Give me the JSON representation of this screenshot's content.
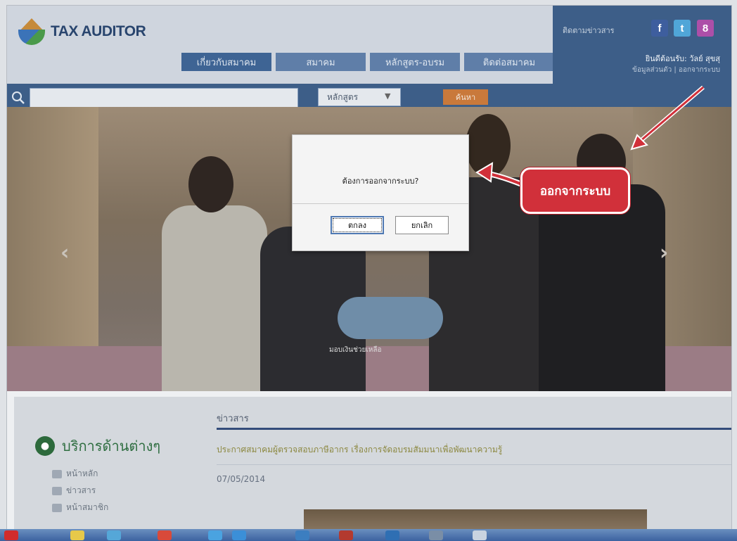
{
  "brand": {
    "logo_text": "TAX AUDITOR",
    "logo_sub": ""
  },
  "nav": {
    "tabs": [
      {
        "label": "เกี่ยวกับสมาคม"
      },
      {
        "label": "สมาคม"
      },
      {
        "label": "หลักสูตร-อบรม"
      },
      {
        "label": "ติดต่อสมาคม"
      }
    ]
  },
  "header_right": {
    "follow_label": "ติดตามข่าวสาร",
    "social": [
      {
        "icon": "facebook-icon",
        "glyph": "f"
      },
      {
        "icon": "twitter-icon",
        "glyph": "t"
      },
      {
        "icon": "googleplus-icon",
        "glyph": "8"
      }
    ],
    "welcome": "ยินดีต้อนรับ: วัลย์ สุขสุ",
    "links": "ข้อมูลส่วนตัว | ออกจากระบบ"
  },
  "search": {
    "placeholder": "",
    "select_value": "หลักสูตร",
    "button_label": "ค้นหา"
  },
  "hero": {
    "caption": "มอบเงินช่วยเหลือ"
  },
  "dialog": {
    "message": "ต้องการออกจากระบบ?",
    "ok_label": "ตกลง",
    "cancel_label": "ยกเลิก"
  },
  "annotation": {
    "text": "ออกจากระบบ"
  },
  "sidebar": {
    "title": "บริการด้านต่างๆ",
    "items": [
      {
        "label": "หน้าหลัก"
      },
      {
        "label": "ข่าวสาร"
      },
      {
        "label": "หน้าสมาชิก"
      }
    ]
  },
  "news": {
    "heading": "ข่าวสาร",
    "title": "ประกาศสมาคมผู้ตรวจสอบภาษีอากร เรื่องการจัดอบรมสัมมนาเพื่อพัฒนาความรู้",
    "date": "07/05/2014"
  },
  "colors": {
    "header_blue": "#3d5e88",
    "accent_orange": "#c9793b",
    "annotation_red": "#d1303a"
  }
}
